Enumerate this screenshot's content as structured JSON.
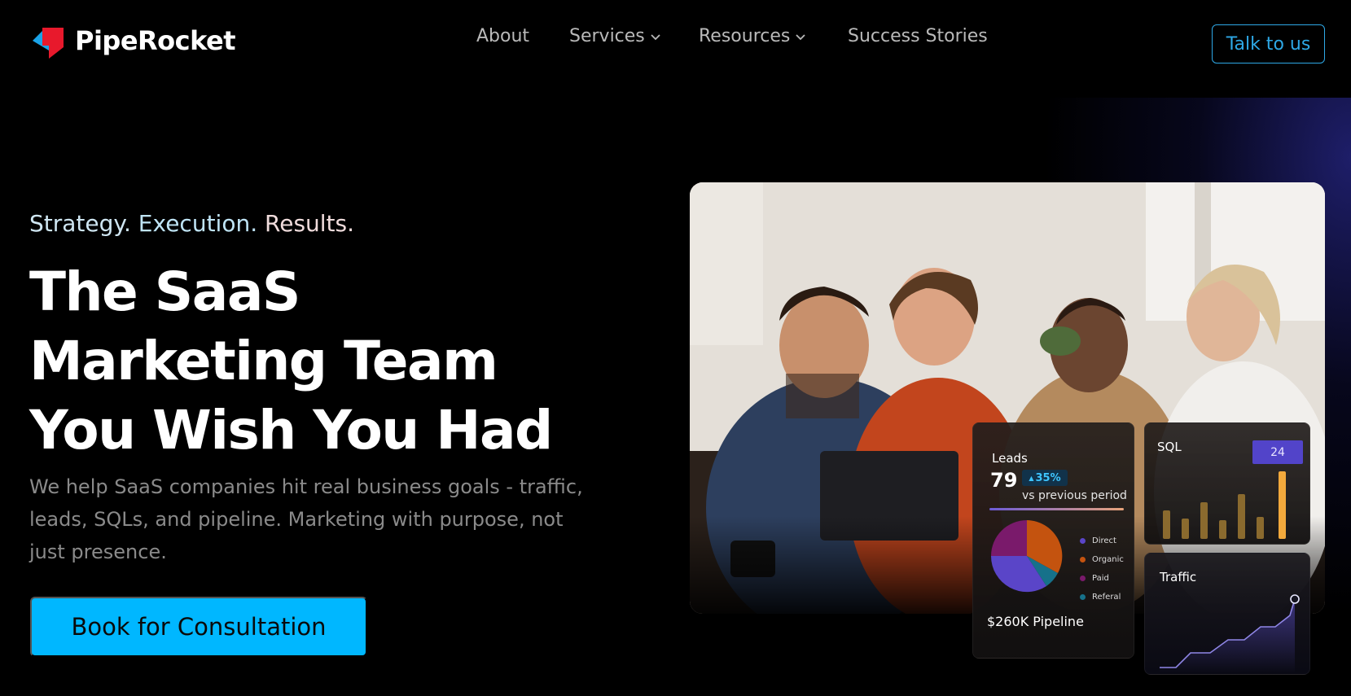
{
  "nav": {
    "brand": "PipeRocket",
    "links": {
      "about": "About",
      "services": "Services",
      "resources": "Resources",
      "success_stories": "Success Stories"
    },
    "cta": "Talk to us"
  },
  "hero": {
    "tagline": {
      "strategy": "Strategy.",
      "execution": "Execution.",
      "results": "Results."
    },
    "headline": "The SaaS Marketing Team You Wish You Had",
    "subtext": "We help SaaS companies hit real business goals - traffic, leads, SQLs, and pipeline. Marketing with purpose, not just presence.",
    "cta": "Book for Consultation"
  },
  "dashboard": {
    "leads": {
      "title": "Leads",
      "value": "79",
      "change": "35%",
      "change_note": "vs previous period",
      "legend": [
        "Direct",
        "Organic",
        "Paid",
        "Referal"
      ],
      "legend_colors": [
        "#5a45c8",
        "#c4530f",
        "#7a1a6b",
        "#16718a"
      ],
      "pipeline": "$260K Pipeline"
    },
    "sql": {
      "title": "SQL",
      "highlight_value": "24"
    },
    "traffic": {
      "title": "Traffic"
    }
  },
  "colors": {
    "accent": "#00b7ff",
    "outline_button": "#2ea8e6",
    "brand_red": "#e8192c",
    "brand_blue": "#1aa3e8"
  }
}
